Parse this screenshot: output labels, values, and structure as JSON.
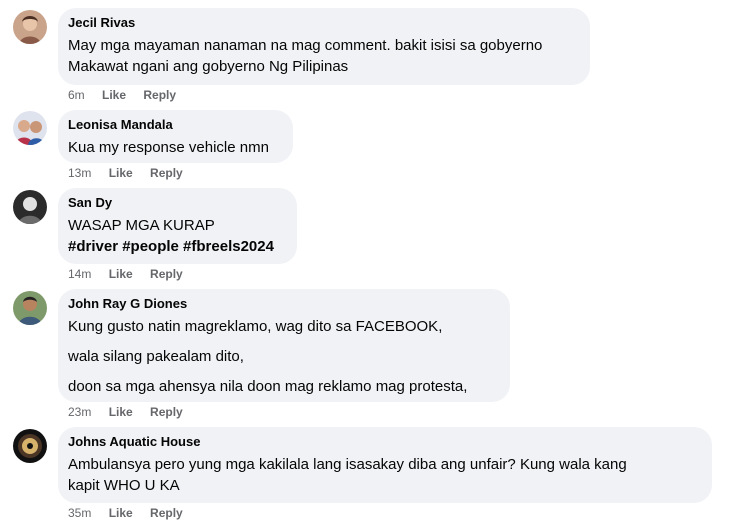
{
  "comments": [
    {
      "author": "Jecil Rivas",
      "lines": [
        "May mga mayaman nanaman na mag comment. bakit isisi sa gobyerno",
        "Makawat ngani ang gobyerno Ng Pilipinas"
      ],
      "time": "6m",
      "like": "Like",
      "reply": "Reply"
    },
    {
      "author": "Leonisa Mandala",
      "lines": [
        "Kua my response vehicle nmn"
      ],
      "time": "13m",
      "like": "Like",
      "reply": "Reply"
    },
    {
      "author": "San Dy",
      "lines": [
        "WASAP MGA KURAP"
      ],
      "hashtags": "#driver #people #fbreels2024",
      "time": "14m",
      "like": "Like",
      "reply": "Reply"
    },
    {
      "author": "John Ray G Diones",
      "lines": [
        "Kung gusto natin magreklamo, wag dito sa FACEBOOK,",
        "wala silang pakealam dito,",
        "doon sa mga ahensya nila doon mag reklamo mag protesta,"
      ],
      "time": "23m",
      "like": "Like",
      "reply": "Reply"
    },
    {
      "author": "Johns Aquatic House",
      "lines": [
        "Ambulansya pero yung mga kakilala lang isasakay diba ang unfair? Kung wala kang",
        "kapit WHO U KA"
      ],
      "time": "35m",
      "like": "Like",
      "reply": "Reply"
    }
  ],
  "colors": {
    "bubble": "#f0f2f5",
    "meta_text": "#65676b",
    "text": "#050505"
  }
}
